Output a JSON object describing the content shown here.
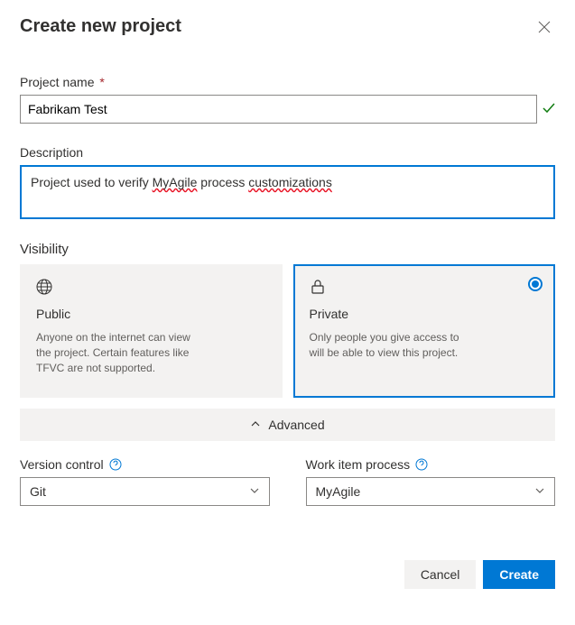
{
  "header": {
    "title": "Create new project"
  },
  "projectName": {
    "label": "Project name",
    "required": "*",
    "value": "Fabrikam Test"
  },
  "description": {
    "label": "Description",
    "text_before": "Project used to verify ",
    "spell1": "MyAgile",
    "text_mid": " process ",
    "spell2": "customizations"
  },
  "visibility": {
    "label": "Visibility",
    "public": {
      "title": "Public",
      "desc": "Anyone on the internet can view the project. Certain features like TFVC are not supported."
    },
    "private": {
      "title": "Private",
      "desc": "Only people you give access to will be able to view this project."
    }
  },
  "advanced": {
    "label": "Advanced",
    "versionControl": {
      "label": "Version control",
      "value": "Git"
    },
    "workItemProcess": {
      "label": "Work item process",
      "value": "MyAgile"
    }
  },
  "footer": {
    "cancel": "Cancel",
    "create": "Create"
  }
}
